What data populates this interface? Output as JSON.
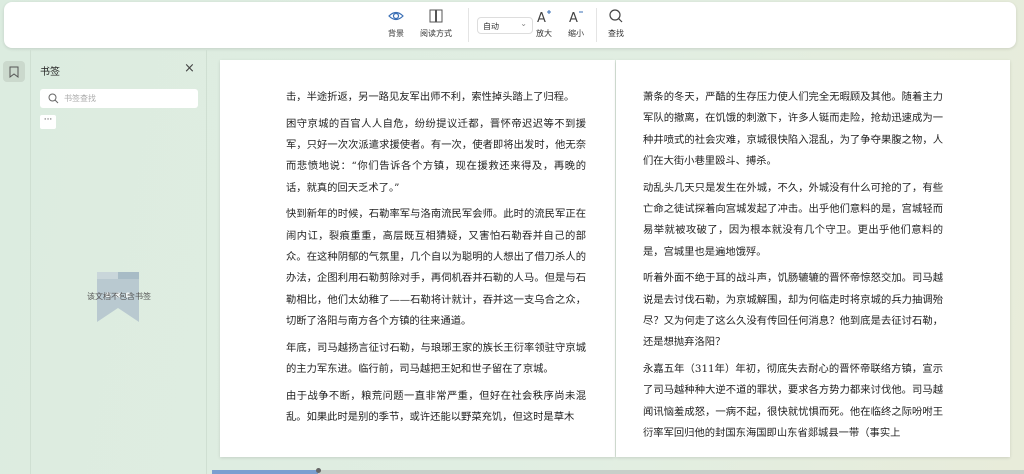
{
  "toolbar": {
    "background": "背景",
    "reading_mode": "阅读方式",
    "zoom_select": "自动",
    "zoom_in": "放大",
    "zoom_out": "缩小",
    "find": "查找"
  },
  "sidebar": {
    "title": "书签",
    "search_placeholder": "书签查找",
    "more": "···",
    "empty_text": "该文档不包含书签"
  },
  "pages": [
    {
      "paragraphs": [
        "击，半途折返，另一路见友军出师不利，索性掉头踏上了归程。",
        "困守京城的百官人人自危，纷纷提议迁都，晋怀帝迟迟等不到援军，只好一次次派遣求援使者。有一次，使者即将出发时，他无奈而悲愤地说：“你们告诉各个方镇，现在援救还来得及，再晚的话，就真的回天乏术了。”",
        "快到新年的时候，石勒率军与洛南流民军会师。此时的流民军正在闹内讧，裂痕重重，高层既互相猜疑，又害怕石勒吞并自己的部众。在这种阴郁的气氛里，几个自以为聪明的人想出了借刀杀人的办法，企图利用石勒剪除对手，再伺机吞并石勒的人马。但是与石勒相比，他们太幼稚了——石勒将计就计，吞并这一支乌合之众，切断了洛阳与南方各个方镇的往来通道。",
        "年底，司马越扬言征讨石勒，与琅琊王家的族长王衍率领驻守京城的主力军东进。临行前，司马越把王妃和世子留在了京城。",
        "由于战争不断，粮荒问题一直非常严重，但好在社会秩序尚未混乱。如果此时是别的季节，或许还能以野菜充饥，但这时是草木"
      ]
    },
    {
      "paragraphs": [
        "萧条的冬天，严酷的生存压力使人们完全无暇顾及其他。随着主力军队的撤离，在饥饿的刺激下，许多人铤而走险，抢劫迅速成为一种井喷式的社会灾难，京城很快陷入混乱，为了争夺果腹之物，人们在大街小巷里殴斗、搏杀。",
        "动乱头几天只是发生在外城，不久，外城没有什么可抢的了，有些亡命之徒试探着向宫城发起了冲击。出乎他们意料的是，宫城轻而易举就被攻破了，因为根本就没有几个守卫。更出乎他们意料的是，宫城里也是遍地饿殍。",
        "听着外面不绝于耳的战斗声，饥肠辘辘的晋怀帝惊怒交加。司马越说是去讨伐石勒，为京城解围，却为何临走时将京城的兵力抽调殆尽？又为何走了这么久没有传回任何消息？他到底是去征讨石勒，还是想抛弃洛阳？",
        "永嘉五年（311年）年初，彻底失去耐心的晋怀帝联络方镇，宣示了司马越种种大逆不道的罪状，要求各方势力都来讨伐他。司马越闻讯恼羞成怒，一病不起，很快就忧惧而死。他在临终之际吩咐王衍率军回归他的封国东海国即山东省郯城县一带（事实上"
      ]
    }
  ],
  "progress": {
    "percent": 13
  }
}
